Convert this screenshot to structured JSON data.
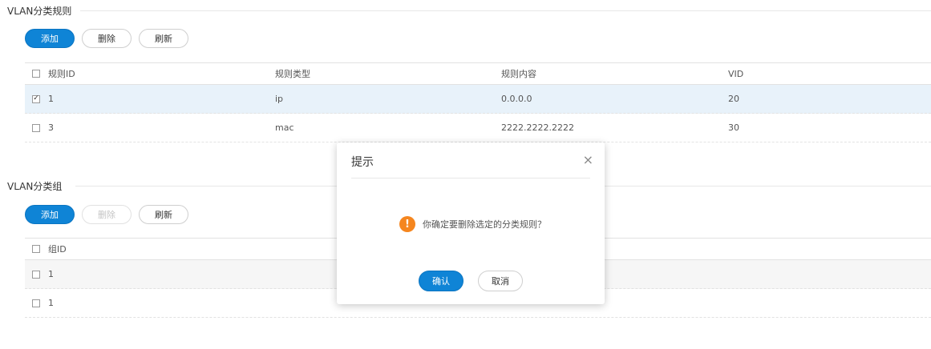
{
  "rules_section": {
    "title": "VLAN分类规则",
    "buttons": {
      "add": "添加",
      "delete": "删除",
      "refresh": "刷新"
    },
    "columns": [
      "规则ID",
      "规则类型",
      "规则内容",
      "VID"
    ],
    "rows": [
      {
        "id": "1",
        "type": "ip",
        "content": "0.0.0.0",
        "vid": "20",
        "checked": true
      },
      {
        "id": "3",
        "type": "mac",
        "content": "2222.2222.2222",
        "vid": "30",
        "checked": false
      }
    ]
  },
  "groups_section": {
    "title": "VLAN分类组",
    "buttons": {
      "add": "添加",
      "delete": "删除",
      "refresh": "刷新"
    },
    "columns": [
      "组ID"
    ],
    "rows": [
      {
        "id": "1"
      },
      {
        "id": "1"
      }
    ]
  },
  "dialog": {
    "title": "提示",
    "close_symbol": "×",
    "message": "你确定要删除选定的分类规则？",
    "warn_symbol": "!",
    "confirm": "确认",
    "cancel": "取消"
  },
  "checkmark": "✓",
  "colors": {
    "primary": "#0f84d6",
    "warning": "#f5861f",
    "selected_row": "#e8f2fa"
  }
}
